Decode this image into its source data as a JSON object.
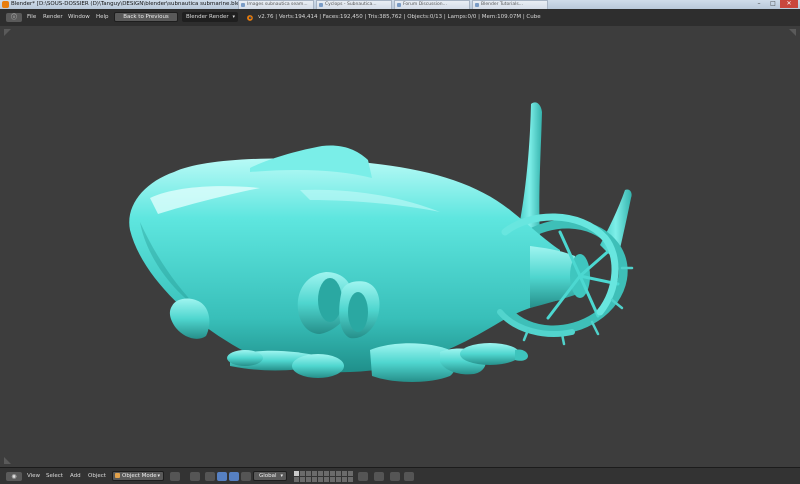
{
  "window": {
    "title": "Blender* [D:\\SOUS-DOSSIER (D)\\Tanguy\\DESIGN\\blender\\subnautica submarine.blend]",
    "controls": {
      "minimize": "–",
      "maximize": "□",
      "close": "✕"
    }
  },
  "background_tabs": [
    "Images subnautica seam...",
    "Cyclops - Subnautica...",
    "Forum Discussion...",
    "Blender Tutorials..."
  ],
  "info_bar": {
    "editor_icon": "info-editor-icon",
    "menus": [
      "File",
      "Render",
      "Window",
      "Help"
    ],
    "back_button": "Back to Previous",
    "render_engine": "Blender Render",
    "stats": "v2.76 | Verts:194,414 | Faces:192,450 | Tris:385,762 | Objects:0/13 | Lamps:0/0 | Mem:109.07M | Cube"
  },
  "viewport": {
    "background": "#3d3d3d",
    "model_color": "#5ee6df",
    "model": "submarine"
  },
  "header": {
    "editor_icon": "3d-view-icon",
    "menus": [
      "View",
      "Select",
      "Add",
      "Object"
    ],
    "mode": "Object Mode",
    "orientation": "Global"
  },
  "colors": {
    "accent": "#5680c2",
    "logo": "#e87d0d"
  }
}
